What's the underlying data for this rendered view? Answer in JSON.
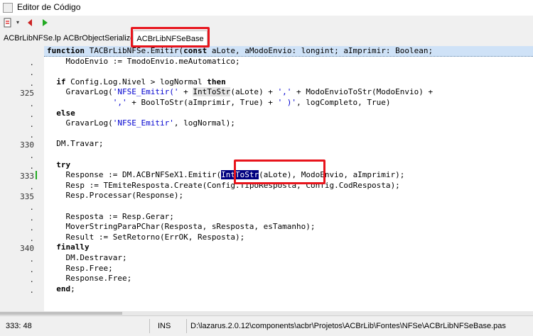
{
  "window": {
    "title": "Editor de Código"
  },
  "toolbar": {
    "items": [
      "new-file-icon",
      "back-icon",
      "forward-icon"
    ]
  },
  "tabs": [
    {
      "label": "ACBrLibNFSe.lpr",
      "active": false
    },
    {
      "label": "ACBrObjectSerializer",
      "active": false
    },
    {
      "label": "ACBrLibNFSeBase",
      "active": true
    }
  ],
  "gutter": [
    {
      "line": 0,
      "text": ""
    },
    {
      "line": 1,
      "text": "."
    },
    {
      "line": 2,
      "text": "."
    },
    {
      "line": 3,
      "text": "."
    },
    {
      "line": 4,
      "text": "325"
    },
    {
      "line": 5,
      "text": "."
    },
    {
      "line": 6,
      "text": "."
    },
    {
      "line": 7,
      "text": "."
    },
    {
      "line": 8,
      "text": "."
    },
    {
      "line": 9,
      "text": "330"
    },
    {
      "line": 10,
      "text": "."
    },
    {
      "line": 11,
      "text": "."
    },
    {
      "line": 12,
      "text": "333"
    },
    {
      "line": 13,
      "text": "."
    },
    {
      "line": 14,
      "text": "335"
    },
    {
      "line": 15,
      "text": "."
    },
    {
      "line": 16,
      "text": "."
    },
    {
      "line": 17,
      "text": "."
    },
    {
      "line": 18,
      "text": "."
    },
    {
      "line": 19,
      "text": "340"
    },
    {
      "line": 20,
      "text": "."
    },
    {
      "line": 21,
      "text": "."
    },
    {
      "line": 22,
      "text": "."
    },
    {
      "line": 23,
      "text": "."
    }
  ],
  "code": [
    "function TACBrLibNFSe.Emitir(const aLote, aModoEnvio: longint; aImprimir: Boolean;",
    "    ModoEnvio := TmodoEnvio.meAutomatico;",
    "",
    "  if Config.Log.Nivel > logNormal then",
    "    GravarLog('NFSE_Emitir(' + IntToStr(aLote) + ',' + ModoEnvioToStr(ModoEnvio) +",
    "              ',' + BoolToStr(aImprimir, True) + ' )', logCompleto, True)",
    "  else",
    "    GravarLog('NFSE_Emitir', logNormal);",
    "",
    "  DM.Travar;",
    "",
    "  try",
    "    Response := DM.ACBrNFSeX1.Emitir(IntToStr(aLote), ModoEnvio, aImprimir);",
    "    Resp := TEmiteResposta.Create(Config.TipoResposta, Config.CodResposta);",
    "    Resp.Processar(Response);",
    "",
    "    Resposta := Resp.Gerar;",
    "    MoverStringParaPChar(Resposta, sResposta, esTamanho);",
    "    Result := SetRetorno(ErrOK, Resposta);",
    "  finally",
    "    DM.Destravar;",
    "    Resp.Free;",
    "    Response.Free;",
    "  end;"
  ],
  "status": {
    "position": "333: 48",
    "mode": "INS",
    "path": "D:\\lazarus.2.0.12\\components\\acbr\\Projetos\\ACBrLib\\Fontes\\NFSe\\ACBrLibNFSeBase.pas"
  },
  "colors": {
    "callout": "#e8141c",
    "selection": "#000080",
    "current_line": "#cfe2f7",
    "modified_marker": "#22aa22"
  }
}
